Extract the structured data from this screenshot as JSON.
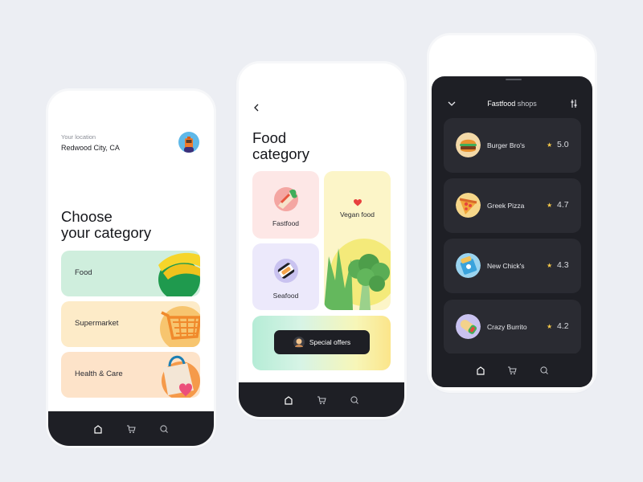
{
  "screen1": {
    "location_label": "Your location",
    "location_value": "Redwood City, CA",
    "headline_line1": "Choose",
    "headline_line2": "your category",
    "categories": [
      {
        "label": "Food",
        "color": "#cfeedd"
      },
      {
        "label": "Supermarket",
        "color": "#fdebc8"
      },
      {
        "label": "Health & Care",
        "color": "#fde3c9"
      }
    ]
  },
  "screen2": {
    "headline_line1": "Food",
    "headline_line2": "category",
    "tiles": [
      {
        "label": "Fastfood",
        "color": "#fde7e6"
      },
      {
        "label": "Seafood",
        "color": "#ece9fb"
      },
      {
        "label": "Vegan food",
        "color": "#fcf5c8"
      }
    ],
    "offers_button": "Special offers"
  },
  "screen3": {
    "title_bold": "Fastfood",
    "title_rest": " shops",
    "shops": [
      {
        "name": "Burger Bro's",
        "rating": "5.0",
        "icon": "burger-icon"
      },
      {
        "name": "Greek Pizza",
        "rating": "4.7",
        "icon": "pizza-icon"
      },
      {
        "name": "New Chick's",
        "rating": "4.3",
        "icon": "chicken-box-icon"
      },
      {
        "name": "Crazy Burrito",
        "rating": "4.2",
        "icon": "burrito-icon"
      }
    ]
  },
  "nav_icons": [
    "home-icon",
    "cart-icon",
    "search-icon"
  ],
  "colors": {
    "background": "#eceef3",
    "dark": "#1e1f25",
    "card_dark": "#2a2b32",
    "star": "#f5c84a"
  }
}
